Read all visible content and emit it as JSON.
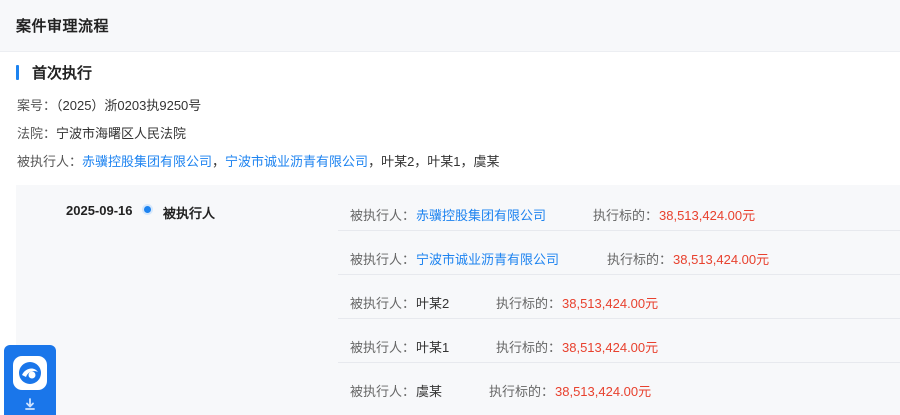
{
  "panel": {
    "title": "案件审理流程"
  },
  "section": {
    "title": "首次执行"
  },
  "case": {
    "number_label": "案号：",
    "number_value": "（2025）浙0203执9250号",
    "court_label": "法院：",
    "court_value": "宁波市海曙区人民法院",
    "executed_label": "被执行人：",
    "executed_links": [
      "赤骥控股集团有限公司",
      "宁波市诚业沥青有限公司"
    ],
    "executed_others": "叶某2，叶某1，虞某",
    "separator": "，"
  },
  "timeline": {
    "date": "2025-09-16",
    "type": "被执行人",
    "entries": [
      {
        "label": "被执行人：",
        "name": "赤骥控股集团有限公司",
        "is_link": true,
        "amount_label": "执行标的：",
        "amount": "38,513,424.00元"
      },
      {
        "label": "被执行人：",
        "name": "宁波市诚业沥青有限公司",
        "is_link": true,
        "amount_label": "执行标的：",
        "amount": "38,513,424.00元"
      },
      {
        "label": "被执行人：",
        "name": "叶某2",
        "is_link": false,
        "amount_label": "执行标的：",
        "amount": "38,513,424.00元"
      },
      {
        "label": "被执行人：",
        "name": "叶某1",
        "is_link": false,
        "amount_label": "执行标的：",
        "amount": "38,513,424.00元"
      },
      {
        "label": "被执行人：",
        "name": "虞某",
        "is_link": false,
        "amount_label": "执行标的：",
        "amount": "38,513,424.00元"
      }
    ]
  },
  "app_badge": {
    "icon": "app-logo-icon",
    "action_icon": "download-icon"
  },
  "colors": {
    "accent": "#1d83f0",
    "amount": "#e8412e",
    "badge": "#1a76ea"
  }
}
